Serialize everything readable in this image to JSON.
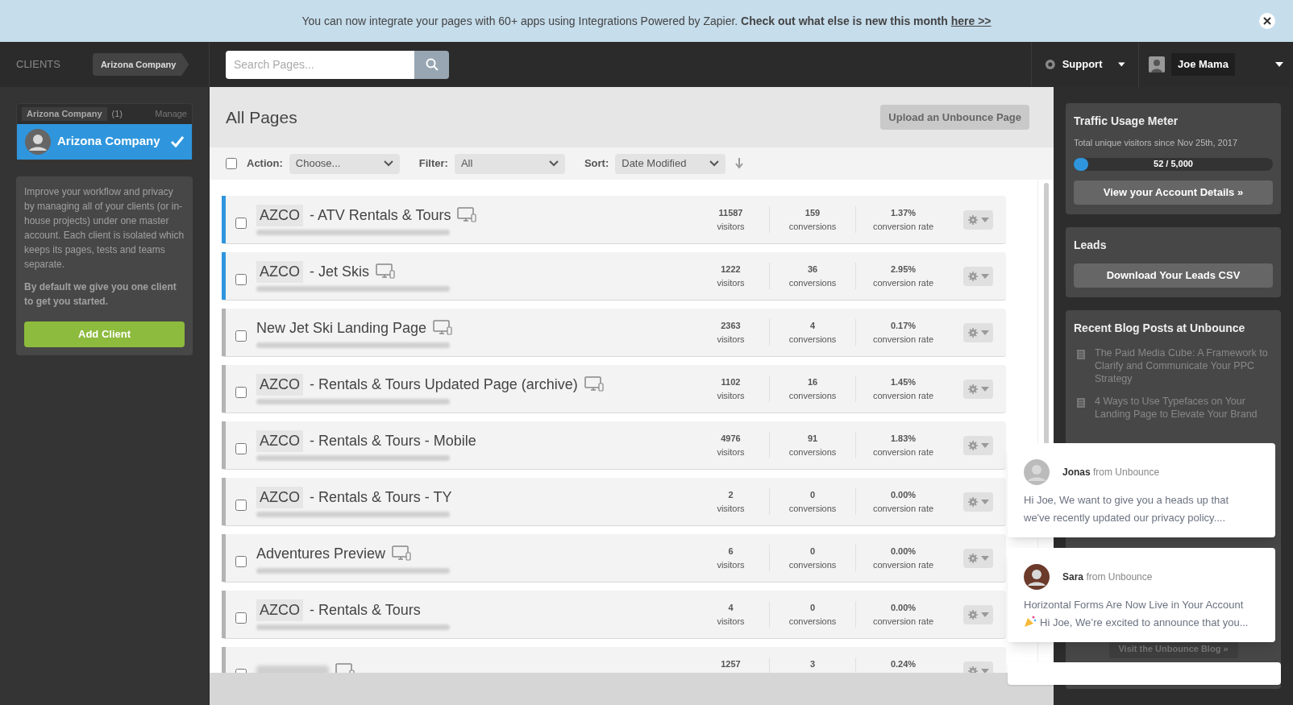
{
  "banner": {
    "text": "You can now integrate your pages with 60+ apps using Integrations Powered by Zapier.",
    "bold": "Check out what else is new this month",
    "link": "here >>"
  },
  "topbar": {
    "clients_label": "CLIENTS",
    "breadcrumb": "Arizona Company",
    "search": {
      "placeholder": "Search Pages..."
    },
    "support": "Support",
    "user": "Joe Mama"
  },
  "sidebar": {
    "group": {
      "name": "Arizona Company",
      "count": "(1)",
      "manage": "Manage"
    },
    "clients": [
      {
        "name": "Arizona Company",
        "selected": true
      }
    ],
    "info": "Improve your workflow and privacy by managing all of your clients (or in-house projects) under one master account. Each client is isolated which keeps its pages, tests and teams separate.",
    "info_bold": "By default we give you one client to get you started.",
    "add_client": "Add Client"
  },
  "main": {
    "title": "All Pages",
    "upload": "Upload an Unbounce Page",
    "toolbar": {
      "select_all_checked": false,
      "action_label": "Action:",
      "action": "Choose...",
      "filter_label": "Filter:",
      "filter": "All",
      "sort_label": "Sort:",
      "sort": "Date Modified"
    },
    "pages": [
      {
        "prefix": "AZCO",
        "title": "- ATV Rentals & Tours",
        "device": true,
        "color": "#2f96dd",
        "checked": false,
        "stats": [
          {
            "value": "11587",
            "label": "visitors"
          },
          {
            "value": "159",
            "label": "conversions"
          },
          {
            "value": "1.37%",
            "label": "conversion rate"
          }
        ]
      },
      {
        "prefix": "AZCO",
        "title": "- Jet Skis",
        "device": true,
        "color": "#2f96dd",
        "checked": false,
        "stats": [
          {
            "value": "1222",
            "label": "visitors"
          },
          {
            "value": "36",
            "label": "conversions"
          },
          {
            "value": "2.95%",
            "label": "conversion rate"
          }
        ]
      },
      {
        "title": "New Jet Ski Landing Page",
        "device": true,
        "color": "#b3b3b3",
        "checked": false,
        "stats": [
          {
            "value": "2363",
            "label": "visitors"
          },
          {
            "value": "4",
            "label": "conversions"
          },
          {
            "value": "0.17%",
            "label": "conversion rate"
          }
        ]
      },
      {
        "prefix": "AZCO",
        "title": "- Rentals & Tours Updated Page (archive)",
        "device": true,
        "color": "#b3b3b3",
        "checked": false,
        "stats": [
          {
            "value": "1102",
            "label": "visitors"
          },
          {
            "value": "16",
            "label": "conversions"
          },
          {
            "value": "1.45%",
            "label": "conversion rate"
          }
        ]
      },
      {
        "prefix": "AZCO",
        "title": "- Rentals & Tours - Mobile",
        "device": false,
        "color": "#b3b3b3",
        "checked": false,
        "stats": [
          {
            "value": "4976",
            "label": "visitors"
          },
          {
            "value": "91",
            "label": "conversions"
          },
          {
            "value": "1.83%",
            "label": "conversion rate"
          }
        ]
      },
      {
        "prefix": "AZCO",
        "title": "- Rentals & Tours - TY",
        "device": false,
        "color": "#b3b3b3",
        "checked": false,
        "stats": [
          {
            "value": "2",
            "label": "visitors"
          },
          {
            "value": "0",
            "label": "conversions"
          },
          {
            "value": "0.00%",
            "label": "conversion rate"
          }
        ]
      },
      {
        "title": "Adventures Preview",
        "device": true,
        "color": "#b3b3b3",
        "checked": false,
        "stats": [
          {
            "value": "6",
            "label": "visitors"
          },
          {
            "value": "0",
            "label": "conversions"
          },
          {
            "value": "0.00%",
            "label": "conversion rate"
          }
        ]
      },
      {
        "prefix": "AZCO",
        "title": "- Rentals & Tours",
        "device": false,
        "color": "#b3b3b3",
        "checked": false,
        "stats": [
          {
            "value": "4",
            "label": "visitors"
          },
          {
            "value": "0",
            "label": "conversions"
          },
          {
            "value": "0.00%",
            "label": "conversion rate"
          }
        ]
      },
      {
        "device": true,
        "color": "#b3b3b3",
        "checked": false,
        "stats": [
          {
            "value": "1257"
          },
          {
            "value": "3"
          },
          {
            "value": "0.24%"
          }
        ]
      }
    ]
  },
  "right": {
    "traffic": {
      "title": "Traffic Usage Meter",
      "subtitle": "Total unique visitors since Nov 25th, 2017",
      "level": 0.0104,
      "reading": "52 / 5,000",
      "button": "View your Account Details »"
    },
    "leads": {
      "title": "Leads",
      "button": "Download Your Leads CSV"
    },
    "blog": {
      "title": "Recent Blog Posts at Unbounce",
      "posts": [
        "The Paid Media Cube: A Framework to Clarify and Communicate Your PPC Strategy",
        "4 Ways to Use Typefaces on Your Landing Page to Elevate Your Brand"
      ],
      "button": "Visit the Unbounce Blog »"
    }
  },
  "notifications": [
    {
      "name": "Jonas",
      "from": "from Unbounce",
      "party": false,
      "lines": [
        "Hi Joe, We want to give you a heads up that",
        "we've recently updated our privacy policy...."
      ]
    },
    {
      "name": "Sara",
      "from": "from Unbounce",
      "lines": [
        "Horizontal Forms Are Now Live in Your Account",
        "Hi Joe, We’re excited to announce that you..."
      ],
      "party": true
    }
  ]
}
